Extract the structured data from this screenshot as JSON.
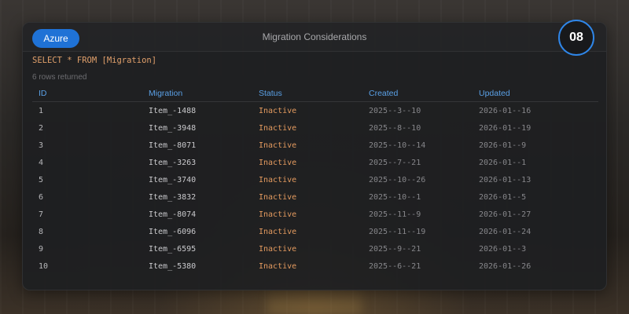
{
  "header": {
    "button_label": "Azure",
    "title": "Migration Considerations",
    "badge": "08"
  },
  "query": {
    "sql": "SELECT * FROM [Migration]",
    "rows_returned": "6 rows returned"
  },
  "table": {
    "columns": [
      "ID",
      "Migration",
      "Status",
      "Created",
      "Updated"
    ],
    "rows": [
      [
        "1",
        "Item_-1488",
        "Inactive",
        "2025--3--10",
        "2026-01--16"
      ],
      [
        "2",
        "Item_-3948",
        "Inactive",
        "2025--8--10",
        "2026-01--19"
      ],
      [
        "3",
        "Item_-8071",
        "Inactive",
        "2025--10--14",
        "2026-01--9"
      ],
      [
        "4",
        "Item_-3263",
        "Inactive",
        "2025--7--21",
        "2026-01--1"
      ],
      [
        "5",
        "Item_-3740",
        "Inactive",
        "2025--10--26",
        "2026-01--13"
      ],
      [
        "6",
        "Item_-3832",
        "Inactive",
        "2025--10--1",
        "2026-01--5"
      ],
      [
        "7",
        "Item_-8074",
        "Inactive",
        "2025--11--9",
        "2026-01--27"
      ],
      [
        "8",
        "Item_-6096",
        "Inactive",
        "2025--11--19",
        "2026-01--24"
      ],
      [
        "9",
        "Item_-6595",
        "Inactive",
        "2025--9--21",
        "2026-01--3"
      ],
      [
        "10",
        "Item_-5380",
        "Inactive",
        "2025--6--21",
        "2026-01--26"
      ]
    ]
  },
  "colors": {
    "accent": "#1f72d6",
    "badge_ring": "#2f86e8",
    "header_text": "#5aa0e6",
    "status_text": "#e39a5f",
    "query_text": "#e1a06b"
  }
}
